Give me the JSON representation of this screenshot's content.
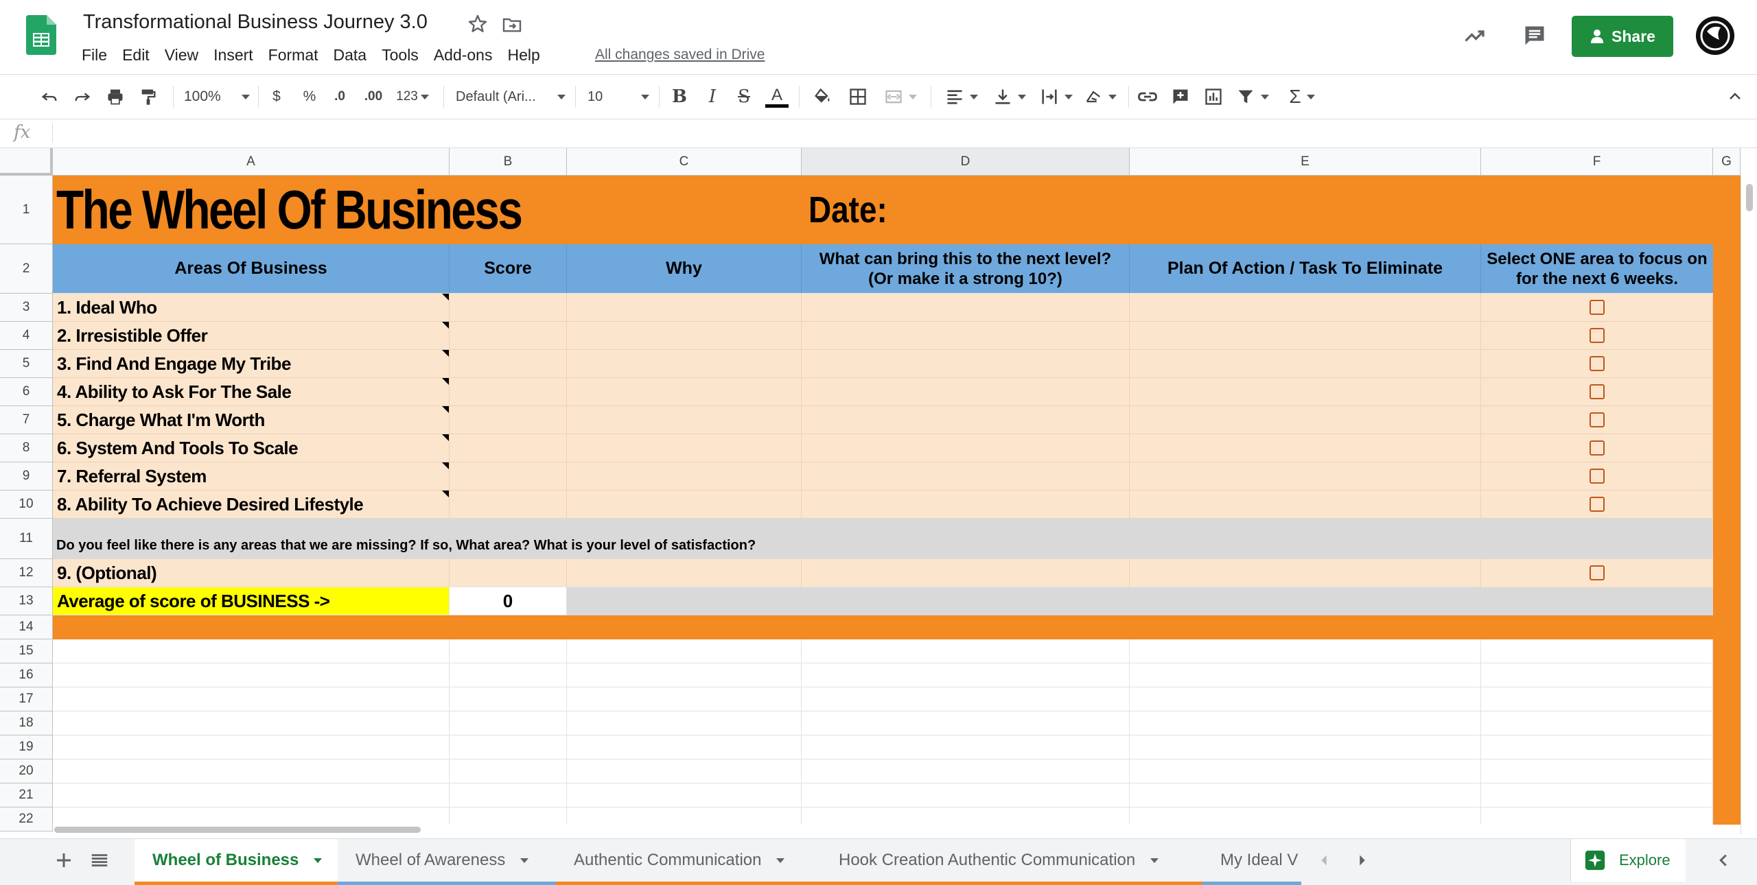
{
  "header": {
    "title": "Transformational Business Journey 3.0",
    "menu": [
      "File",
      "Edit",
      "View",
      "Insert",
      "Format",
      "Data",
      "Tools",
      "Add-ons",
      "Help"
    ],
    "saved_status": "All changes saved in Drive",
    "share_label": "Share"
  },
  "toolbar": {
    "zoom": "100%",
    "currency": "$",
    "percent": "%",
    "decrease_decimal": ".0",
    "increase_decimal": ".00",
    "more_formats": "123",
    "font": "Default (Ari...",
    "font_size": "10",
    "text_color": "#000000"
  },
  "formula_bar": {
    "fx": "fx",
    "value": ""
  },
  "columns": [
    "A",
    "B",
    "C",
    "D",
    "E",
    "F",
    "G"
  ],
  "rows": [
    "1",
    "2",
    "3",
    "4",
    "5",
    "6",
    "7",
    "8",
    "9",
    "10",
    "11",
    "12",
    "13",
    "14",
    "15",
    "16",
    "17",
    "18",
    "19",
    "20",
    "21",
    "22"
  ],
  "sheet": {
    "title": "The Wheel Of Business",
    "date_label": "Date:",
    "headers": {
      "area": "Areas Of Business",
      "score": "Score",
      "why": "Why",
      "next_level": "What can bring this to the next level? (Or make it a strong 10?)",
      "plan": "Plan Of Action / Task To Eliminate",
      "select": "Select ONE area to focus on for the next 6 weeks."
    },
    "areas": [
      "1. Ideal Who",
      "2. Irresistible Offer",
      "3. Find And Engage My Tribe",
      "4. Ability to Ask For The Sale",
      "5. Charge What I'm Worth",
      "6. System And Tools To Scale",
      "7. Referral System",
      "8. Ability To Achieve Desired Lifestyle"
    ],
    "missing_question": "Do you feel like there is any areas that we are missing? If so, What area? What is your level of satisfaction?",
    "optional": "9. (Optional)",
    "average_label": "Average of score of BUSINESS ->",
    "average_value": "0",
    "colors": {
      "orange": "#f38a22",
      "blue": "#6fa8dc",
      "peach": "#fce5cd",
      "gray": "#d9d9d9",
      "yellow": "#ffff00"
    }
  },
  "sheet_tabs": [
    {
      "label": "Wheel of Business",
      "color": "#f38a22",
      "active": true
    },
    {
      "label": "Wheel of Awareness",
      "color": "#6fa8dc",
      "active": false
    },
    {
      "label": "Authentic Communication",
      "color": "#f38a22",
      "active": false
    },
    {
      "label": "Hook Creation Authentic Communication",
      "color": "#f38a22",
      "active": false
    },
    {
      "label": "My Ideal V",
      "color": "#6fa8dc",
      "active": false
    }
  ],
  "explore_label": "Explore"
}
